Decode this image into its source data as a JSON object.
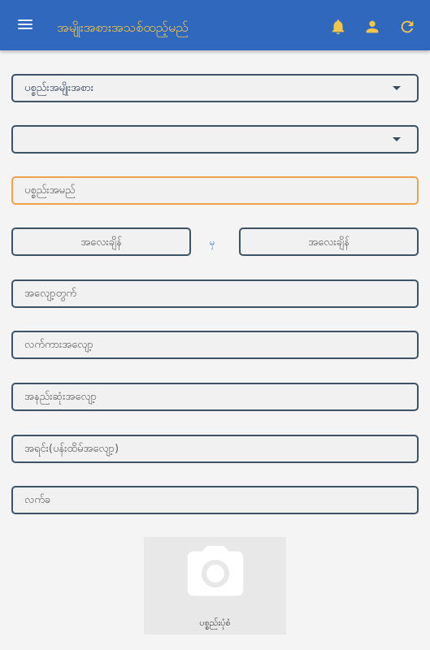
{
  "appbar": {
    "title": "အမျိုးအစားအသစ်ထည့်မည်",
    "icons": [
      "menu-icon",
      "bell-icon",
      "person-icon",
      "refresh-icon"
    ]
  },
  "form": {
    "category_select": "ပစ္စည်းအမျိုးအစား",
    "subcategory_select": "",
    "item_name_placeholder": "ပစ္စည်းအမည်",
    "weight_from_placeholder": "အလေးချိန်",
    "separator": "မှ",
    "weight_to_placeholder": "အလေးချိန်",
    "discount_placeholder": "အလျော့တွက်",
    "labour_placeholder": "လက်ကားအလျော့",
    "min_discount_placeholder": "အနည်းဆုံးအလျော့",
    "net_placeholder": "အရင်း(ပန်းထိမ်အလျော့)",
    "fee_placeholder": "လက်ခ",
    "photo_label": "ပစ္စည်းပုံစံ"
  },
  "colors": {
    "appbar": "#3068bd",
    "title": "#f3c64a",
    "field_border": "#3e5365",
    "focus_border": "#efa24b"
  }
}
